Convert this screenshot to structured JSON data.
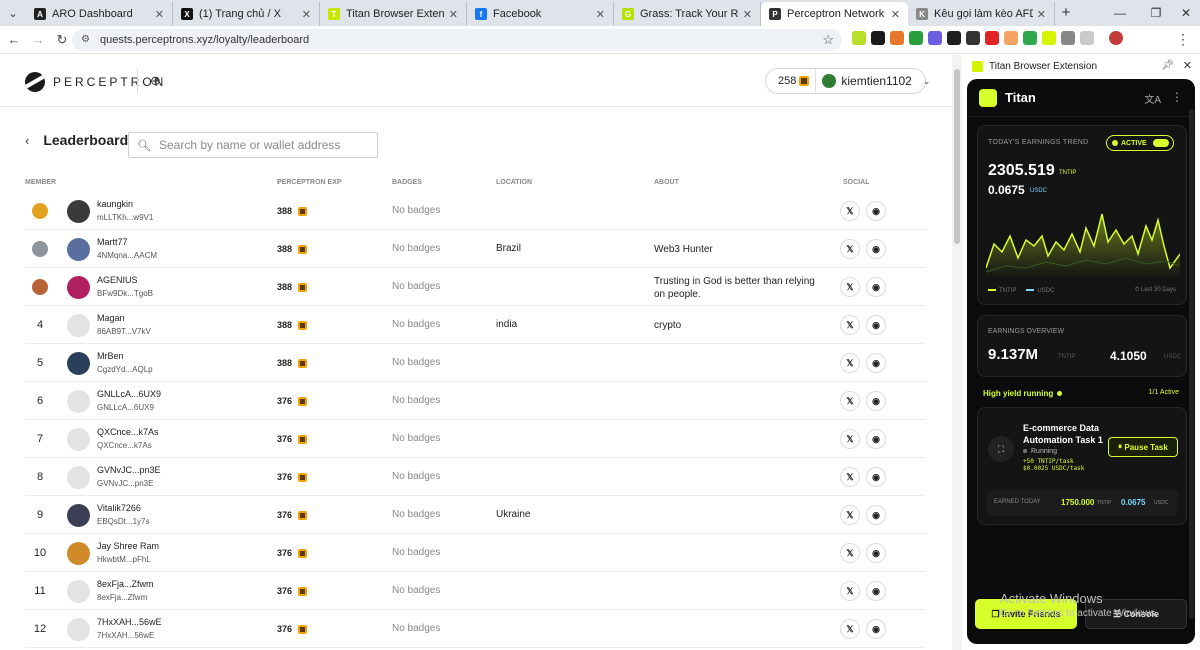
{
  "browser": {
    "tabs": [
      {
        "title": "ARO Dashboard",
        "fav_color": "#222222",
        "fav_glyph": "A"
      },
      {
        "title": "(1) Trang chủ / X",
        "fav_color": "#111111",
        "fav_glyph": "X"
      },
      {
        "title": "Titan Browser Extension",
        "fav_color": "#c9e600",
        "fav_glyph": "T"
      },
      {
        "title": "Facebook",
        "fav_color": "#1877f2",
        "fav_glyph": "f"
      },
      {
        "title": "Grass: Track Your Rewards",
        "fav_color": "#b6e000",
        "fav_glyph": "G"
      },
      {
        "title": "Perceptron Network",
        "fav_color": "#333333",
        "fav_glyph": "P"
      },
      {
        "title": "Kêu gọi làm kèo AFD",
        "fav_color": "#888888",
        "fav_glyph": "K"
      }
    ],
    "url": "quests.perceptrons.xyz/loyalty/leaderboard"
  },
  "site": {
    "logo_text": "PERCEPTRON",
    "points": "258",
    "username": "kiemtien1102"
  },
  "leaderboard": {
    "title": "Leaderboard",
    "search_placeholder": "Search by name or wallet address",
    "columns": {
      "member": "MEMBER",
      "exp": "PERCEPTRON EXP",
      "badges": "BADGES",
      "location": "LOCATION",
      "about": "ABOUT",
      "social": "SOCIAL"
    },
    "rows": [
      {
        "rank": "",
        "medal": "gold",
        "name": "kaungkin",
        "addr": "mLLTKh...w9V1",
        "exp": "388",
        "badges": "No badges",
        "location": "",
        "about": "",
        "avatar": "#3a3a3a"
      },
      {
        "rank": "",
        "medal": "silver",
        "name": "Martt77",
        "addr": "4NMqna...AACM",
        "exp": "388",
        "badges": "No badges",
        "location": "Brazil",
        "about": "Web3 Hunter",
        "avatar": "#5a6fa0"
      },
      {
        "rank": "",
        "medal": "bronze",
        "name": "AGENIUS",
        "addr": "BFw9Dk...TgoB",
        "exp": "388",
        "badges": "No badges",
        "location": "",
        "about": "Trusting in God is better than relying on people.",
        "avatar": "#b02060"
      },
      {
        "rank": "4",
        "medal": "",
        "name": "Magan",
        "addr": "86AB9T...V7kV",
        "exp": "388",
        "badges": "No badges",
        "location": "india",
        "about": "crypto",
        "avatar": "#e3e3e3"
      },
      {
        "rank": "5",
        "medal": "",
        "name": "MrBen",
        "addr": "CgzdYd...AQLp",
        "exp": "388",
        "badges": "No badges",
        "location": "",
        "about": "",
        "avatar": "#2a3f5c"
      },
      {
        "rank": "6",
        "medal": "",
        "name": "GNLLcA...6UX9",
        "addr": "GNLLcA...6UX9",
        "exp": "376",
        "badges": "No badges",
        "location": "",
        "about": "",
        "avatar": "#e3e3e3"
      },
      {
        "rank": "7",
        "medal": "",
        "name": "QXCnce...k7As",
        "addr": "QXCnce...k7As",
        "exp": "376",
        "badges": "No badges",
        "location": "",
        "about": "",
        "avatar": "#e3e3e3"
      },
      {
        "rank": "8",
        "medal": "",
        "name": "GVNvJC...pn3E",
        "addr": "GVNvJC...pn3E",
        "exp": "376",
        "badges": "No badges",
        "location": "",
        "about": "",
        "avatar": "#e3e3e3"
      },
      {
        "rank": "9",
        "medal": "",
        "name": "Vitalik7266",
        "addr": "EBQsDt...1y7s",
        "exp": "376",
        "badges": "No badges",
        "location": "Ukraine",
        "about": "",
        "avatar": "#3b3f55"
      },
      {
        "rank": "10",
        "medal": "",
        "name": "Jay Shree Ram",
        "addr": "HkwbtM...pFhL",
        "exp": "376",
        "badges": "No badges",
        "location": "",
        "about": "",
        "avatar": "#d08a2a"
      },
      {
        "rank": "11",
        "medal": "",
        "name": "8exFja...Zfwm",
        "addr": "8exFja...Zfwm",
        "exp": "376",
        "badges": "No badges",
        "location": "",
        "about": "",
        "avatar": "#e3e3e3"
      },
      {
        "rank": "12",
        "medal": "",
        "name": "7HxXAH...56wE",
        "addr": "7HxXAH...56wE",
        "exp": "376",
        "badges": "No badges",
        "location": "",
        "about": "",
        "avatar": "#e3e3e3"
      }
    ]
  },
  "extension": {
    "panel_title": "Titan Browser Extension",
    "app_name": "Titan",
    "trend_label": "TODAY'S EARNINGS TREND",
    "active_label": "ACTIVE",
    "earn_tntip": "2305.519",
    "unit_tntip": "TNTIP",
    "earn_usdc": "0.0675",
    "unit_usdc": "USDC",
    "legend_tntip": "TNTIP",
    "legend_usdc": "USDC",
    "last_days": "Last 30 Days",
    "overview_label": "EARNINGS OVERVIEW",
    "overview_tntip": "9.137M",
    "overview_tntip_unit": "TNTIP",
    "overview_usdc": "4.1050",
    "overview_usdc_unit": "USDC",
    "yield_text": "High yield running",
    "yield_active": "1/1 Active",
    "task_title": "E-commerce Data Automation Task 1",
    "task_status": "Running",
    "task_rate1": "+50 TNTIP/task",
    "task_rate2": "$0.0025 USDC/task",
    "pause_label": "Pause Task",
    "earned_label": "EARNED TODAY",
    "earned_tntip": "1750.000",
    "earned_tntip_unit": "TNTIP",
    "earned_usdc": "0.0675",
    "earned_usdc_unit": "USDC",
    "invite_label": "Invite Friends",
    "console_label": "Console",
    "accent": "#d7ff2b"
  },
  "os": {
    "activate_title": "Activate Windows",
    "activate_sub": "Go to Settings to activate Windows."
  }
}
